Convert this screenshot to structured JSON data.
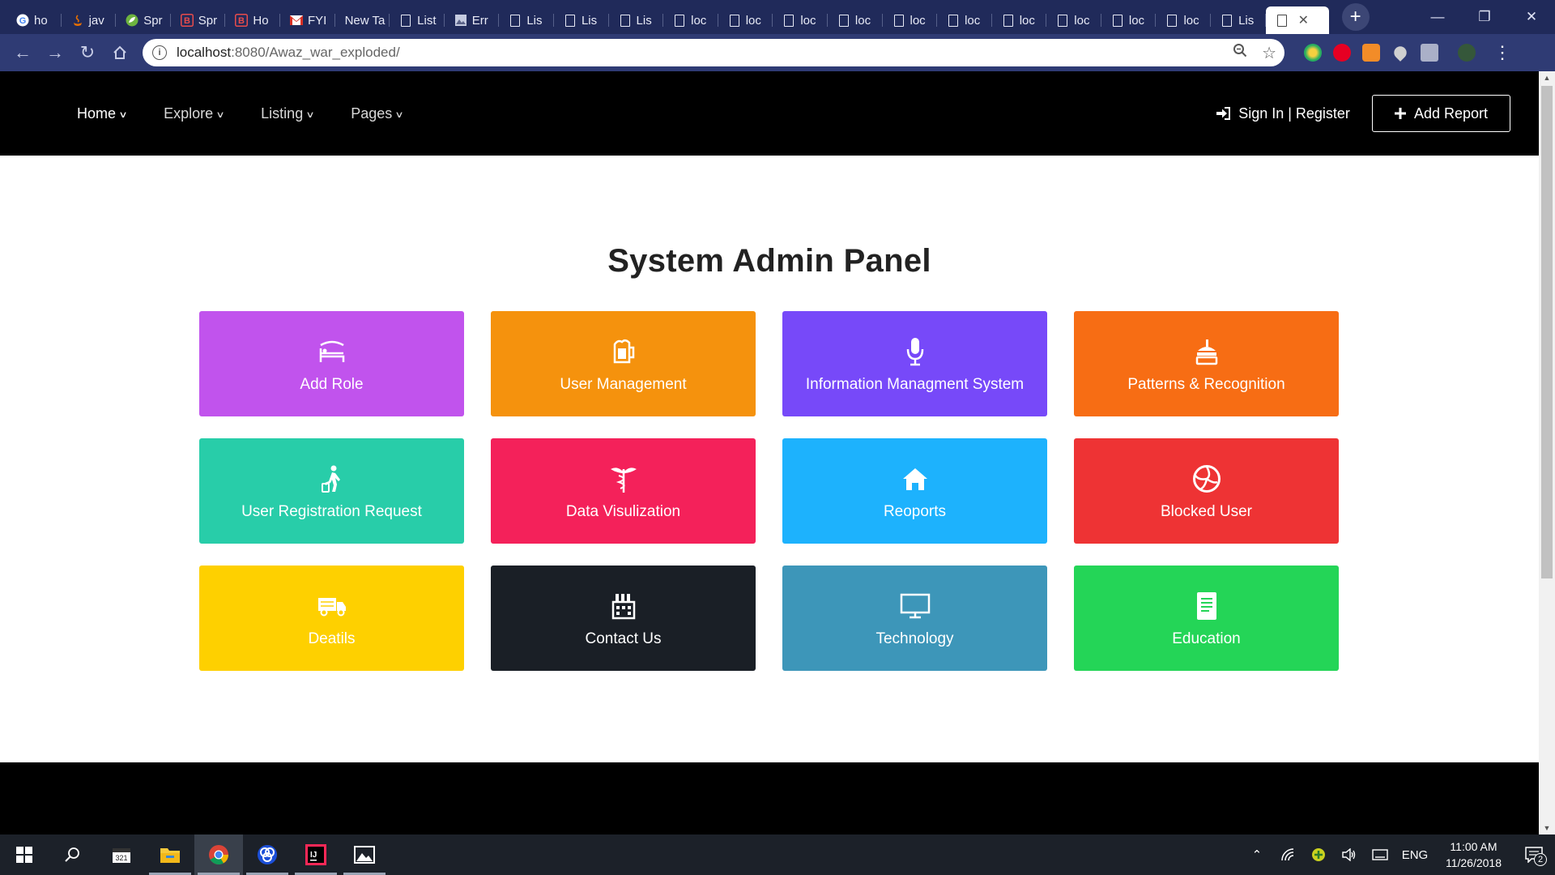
{
  "browser": {
    "tabs": [
      {
        "label": "ho",
        "icon": "google-icon"
      },
      {
        "label": "jav",
        "icon": "java-icon"
      },
      {
        "label": "Spr",
        "icon": "spring-icon"
      },
      {
        "label": "Spr",
        "icon": "bootstrap-icon"
      },
      {
        "label": "Ho",
        "icon": "bootstrap-icon"
      },
      {
        "label": "FYI",
        "icon": "gmail-icon"
      },
      {
        "label": "New Ta",
        "icon": ""
      },
      {
        "label": "List",
        "icon": "page-icon"
      },
      {
        "label": "Err",
        "icon": "image-icon"
      },
      {
        "label": "Lis",
        "icon": "page-icon"
      },
      {
        "label": "Lis",
        "icon": "page-icon"
      },
      {
        "label": "Lis",
        "icon": "page-icon"
      },
      {
        "label": "loc",
        "icon": "page-icon"
      },
      {
        "label": "loc",
        "icon": "page-icon"
      },
      {
        "label": "loc",
        "icon": "page-icon"
      },
      {
        "label": "loc",
        "icon": "page-icon"
      },
      {
        "label": "loc",
        "icon": "page-icon"
      },
      {
        "label": "loc",
        "icon": "page-icon"
      },
      {
        "label": "loc",
        "icon": "page-icon"
      },
      {
        "label": "loc",
        "icon": "page-icon"
      },
      {
        "label": "loc",
        "icon": "page-icon"
      },
      {
        "label": "loc",
        "icon": "page-icon"
      },
      {
        "label": "Lis",
        "icon": "page-icon"
      }
    ],
    "url_host": "localhost",
    "url_rest": ":8080/Awaz_war_exploded/"
  },
  "nav": {
    "menu": [
      {
        "label": "Home"
      },
      {
        "label": "Explore"
      },
      {
        "label": "Listing"
      },
      {
        "label": "Pages"
      }
    ],
    "signin_label": "Sign In | Register",
    "add_report_label": "Add Report"
  },
  "page_title": "System Admin Panel",
  "cards": [
    {
      "label": "Add Role",
      "color": "#c153ed",
      "icon": "bed-icon"
    },
    {
      "label": "User Management",
      "color": "#f5920d",
      "icon": "beer-mug-icon"
    },
    {
      "label": "Information Managment System",
      "color": "#7749f9",
      "icon": "microphone-icon"
    },
    {
      "label": "Patterns & Recognition",
      "color": "#f76d14",
      "icon": "burger-drink-icon"
    },
    {
      "label": "User Registration Request",
      "color": "#28cda9",
      "icon": "traveler-icon"
    },
    {
      "label": "Data Visulization",
      "color": "#f4215a",
      "icon": "caduceus-icon"
    },
    {
      "label": "Reoports",
      "color": "#1db2fd",
      "icon": "home-icon"
    },
    {
      "label": "Blocked User",
      "color": "#ee3334",
      "icon": "volleyball-icon"
    },
    {
      "label": "Deatils",
      "color": "#fed000",
      "icon": "truck-icon"
    },
    {
      "label": "Contact Us",
      "color": "#1a1f26",
      "icon": "factory-icon"
    },
    {
      "label": "Technology",
      "color": "#3d96b9",
      "icon": "monitor-icon"
    },
    {
      "label": "Education",
      "color": "#24d557",
      "icon": "book-icon"
    }
  ],
  "taskbar": {
    "language": "ENG",
    "time": "11:00 AM",
    "date": "11/26/2018",
    "notifications": "2"
  }
}
